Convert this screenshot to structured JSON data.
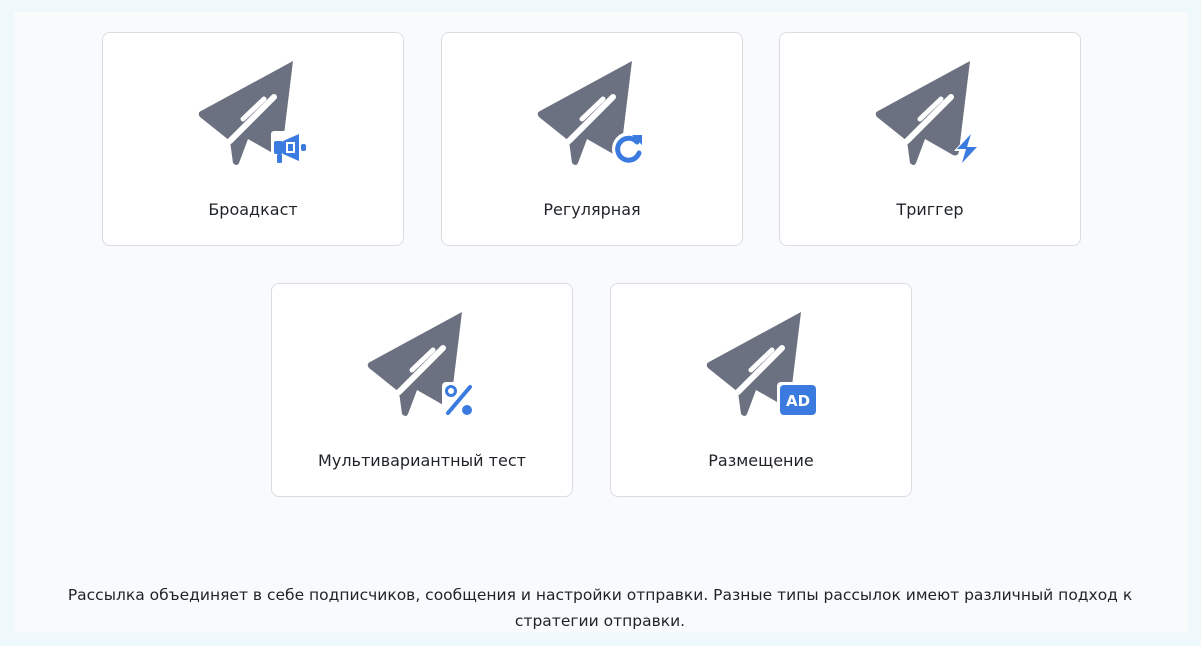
{
  "colors": {
    "page_background": "#eff9fc",
    "panel_background": "#f8fafc",
    "card_border": "#d9dde3",
    "plane_icon": "#6b7180",
    "badge_accent": "#3b7be0"
  },
  "cards": [
    {
      "label": "Броадкаст",
      "icon": "paper-plane-icon",
      "badge": "megaphone-icon"
    },
    {
      "label": "Регулярная",
      "icon": "paper-plane-icon",
      "badge": "refresh-icon"
    },
    {
      "label": "Триггер",
      "icon": "paper-plane-icon",
      "badge": "lightning-icon"
    },
    {
      "label": "Мультивариантный тест",
      "icon": "paper-plane-icon",
      "badge": "percent-icon"
    },
    {
      "label": "Размещение",
      "icon": "paper-plane-icon",
      "badge": "ad-icon",
      "badge_text": "AD"
    }
  ],
  "description": "Рассылка объединяет в себе подписчиков, сообщения и настройки отправки. Разные типы рассылок имеют различный подход к стратегии отправки."
}
